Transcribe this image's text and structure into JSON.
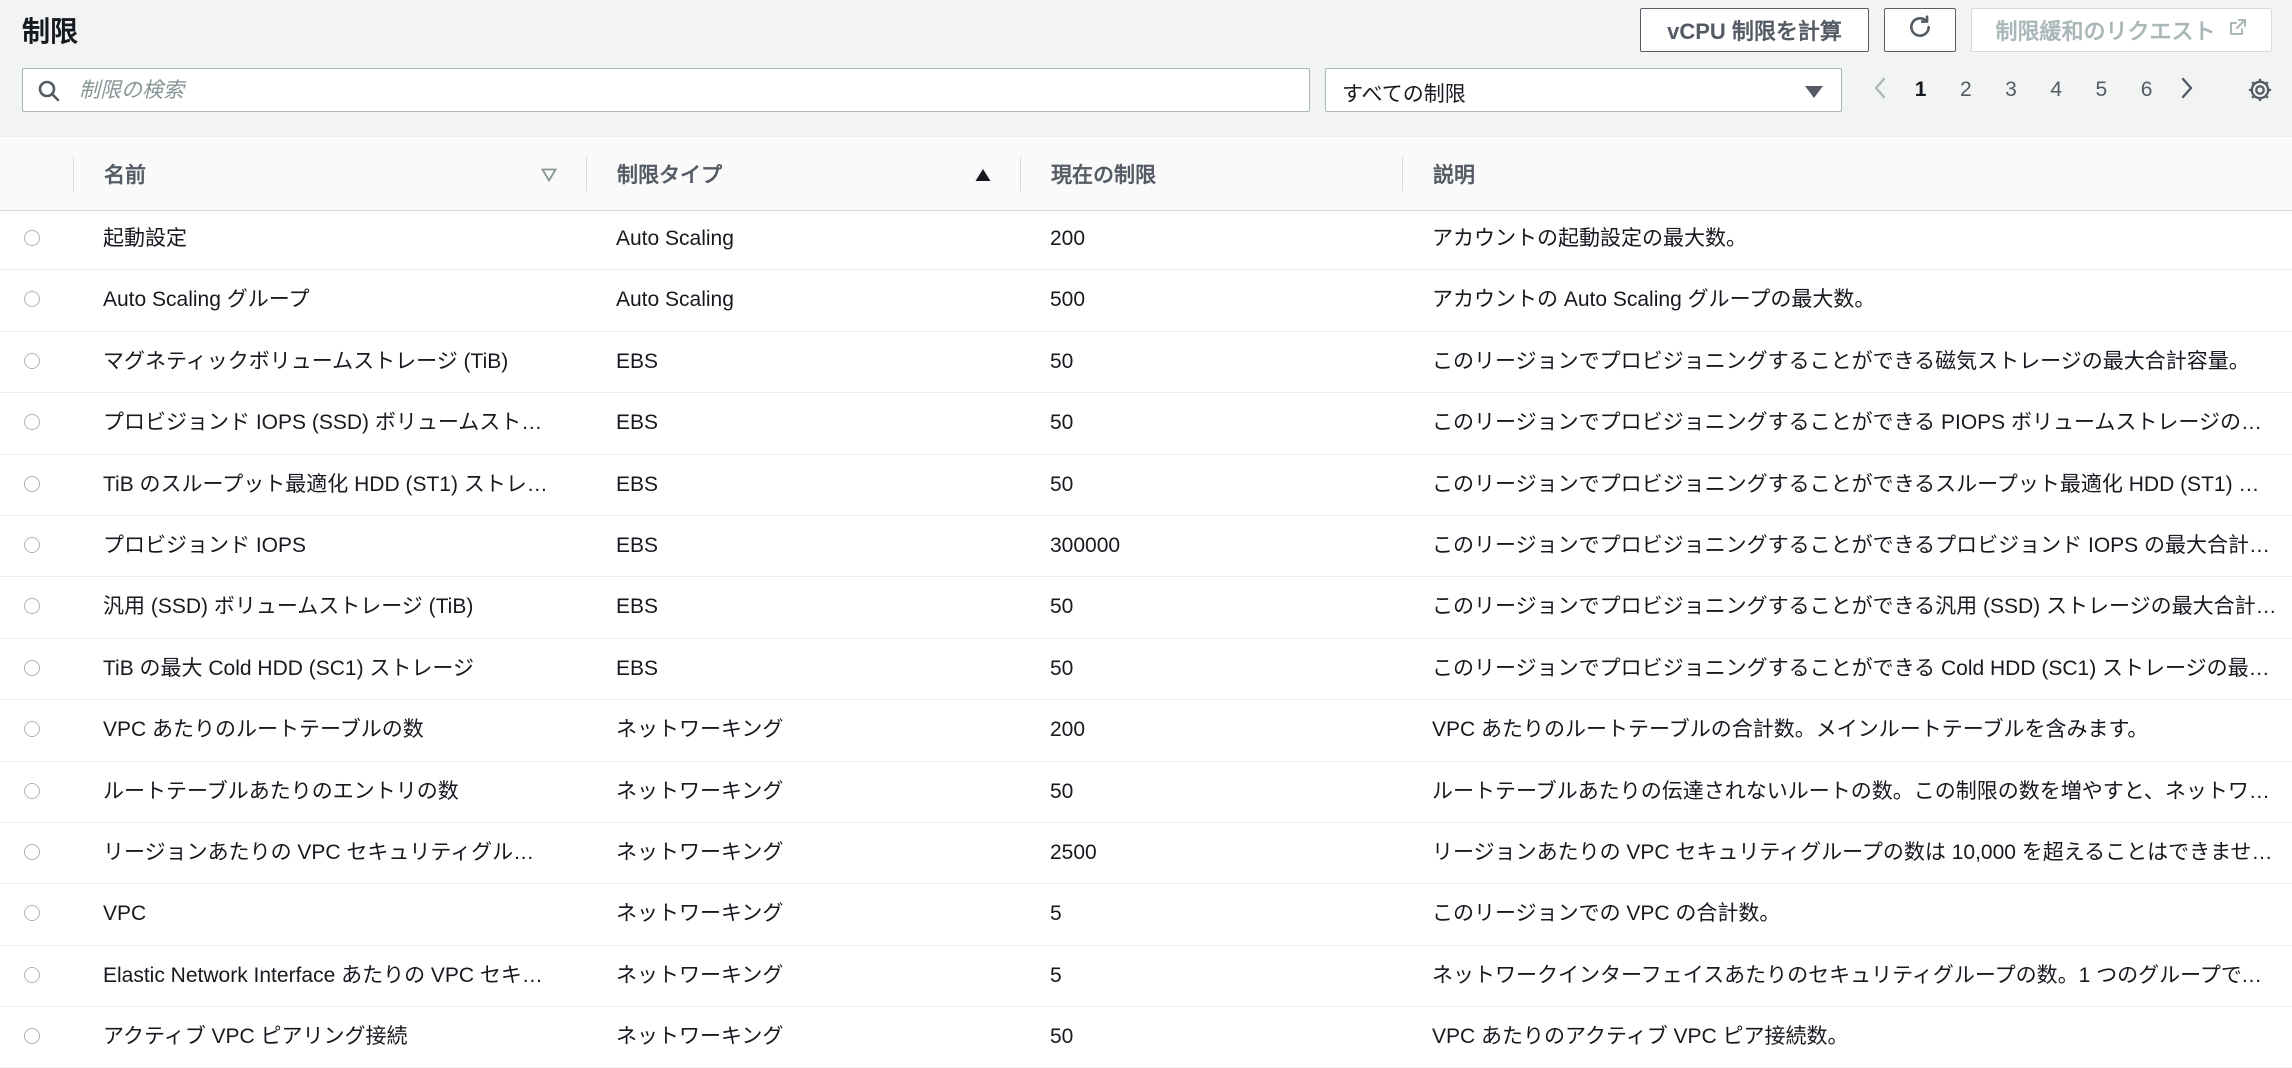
{
  "page": {
    "title": "制限"
  },
  "toolbar": {
    "calc_vcpu_label": "vCPU 制限を計算",
    "request_label": "制限緩和のリクエスト"
  },
  "search": {
    "placeholder": "制限の検索",
    "value": ""
  },
  "filter": {
    "selected": "すべての制限"
  },
  "pagination": {
    "current": "1",
    "pages": [
      "1",
      "2",
      "3",
      "4",
      "5",
      "6"
    ]
  },
  "table": {
    "columns": {
      "name": "名前",
      "type": "制限タイプ",
      "limit": "現在の制限",
      "description": "説明"
    },
    "rows": [
      {
        "name": "起動設定",
        "type": "Auto Scaling",
        "limit": "200",
        "description": "アカウントの起動設定の最大数。"
      },
      {
        "name": "Auto Scaling グループ",
        "type": "Auto Scaling",
        "limit": "500",
        "description": "アカウントの Auto Scaling グループの最大数。"
      },
      {
        "name": "マグネティックボリュームストレージ (TiB)",
        "type": "EBS",
        "limit": "50",
        "description": "このリージョンでプロビジョニングすることができる磁気ストレージの最大合計容量。"
      },
      {
        "name": "プロビジョンド IOPS (SSD) ボリュームストレ…",
        "type": "EBS",
        "limit": "50",
        "description": "このリージョンでプロビジョニングすることができる PIOPS ボリュームストレージの最…"
      },
      {
        "name": "TiB のスループット最適化 HDD (ST1) ストレ…",
        "type": "EBS",
        "limit": "50",
        "description": "このリージョンでプロビジョニングすることができるスループット最適化 HDD (ST1) ス…"
      },
      {
        "name": "プロビジョンド IOPS",
        "type": "EBS",
        "limit": "300000",
        "description": "このリージョンでプロビジョニングすることができるプロビジョンド IOPS の最大合計…"
      },
      {
        "name": "汎用 (SSD) ボリュームストレージ (TiB)",
        "type": "EBS",
        "limit": "50",
        "description": "このリージョンでプロビジョニングすることができる汎用 (SSD) ストレージの最大合計…"
      },
      {
        "name": "TiB の最大 Cold HDD (SC1) ストレージ",
        "type": "EBS",
        "limit": "50",
        "description": "このリージョンでプロビジョニングすることができる Cold HDD (SC1) ストレージの最…"
      },
      {
        "name": "VPC あたりのルートテーブルの数",
        "type": "ネットワーキング",
        "limit": "200",
        "description": "VPC あたりのルートテーブルの合計数。メインルートテーブルを含みます。"
      },
      {
        "name": "ルートテーブルあたりのエントリの数",
        "type": "ネットワーキング",
        "limit": "50",
        "description": "ルートテーブルあたりの伝達されないルートの数。この制限の数を増やすと、ネットワ…"
      },
      {
        "name": "リージョンあたりの VPC セキュリティグルー…",
        "type": "ネットワーキング",
        "limit": "2500",
        "description": "リージョンあたりの VPC セキュリティグループの数は 10,000 を超えることはできませ…"
      },
      {
        "name": "VPC",
        "type": "ネットワーキング",
        "limit": "5",
        "description": "このリージョンでの VPC の合計数。"
      },
      {
        "name": "Elastic Network Interface あたりの VPC セキ…",
        "type": "ネットワーキング",
        "limit": "5",
        "description": "ネットワークインターフェイスあたりのセキュリティグループの数。1 つのグループで、…"
      },
      {
        "name": "アクティブ VPC ピアリング接続",
        "type": "ネットワーキング",
        "limit": "50",
        "description": "VPC あたりのアクティブ VPC ピア接続数。"
      }
    ]
  }
}
